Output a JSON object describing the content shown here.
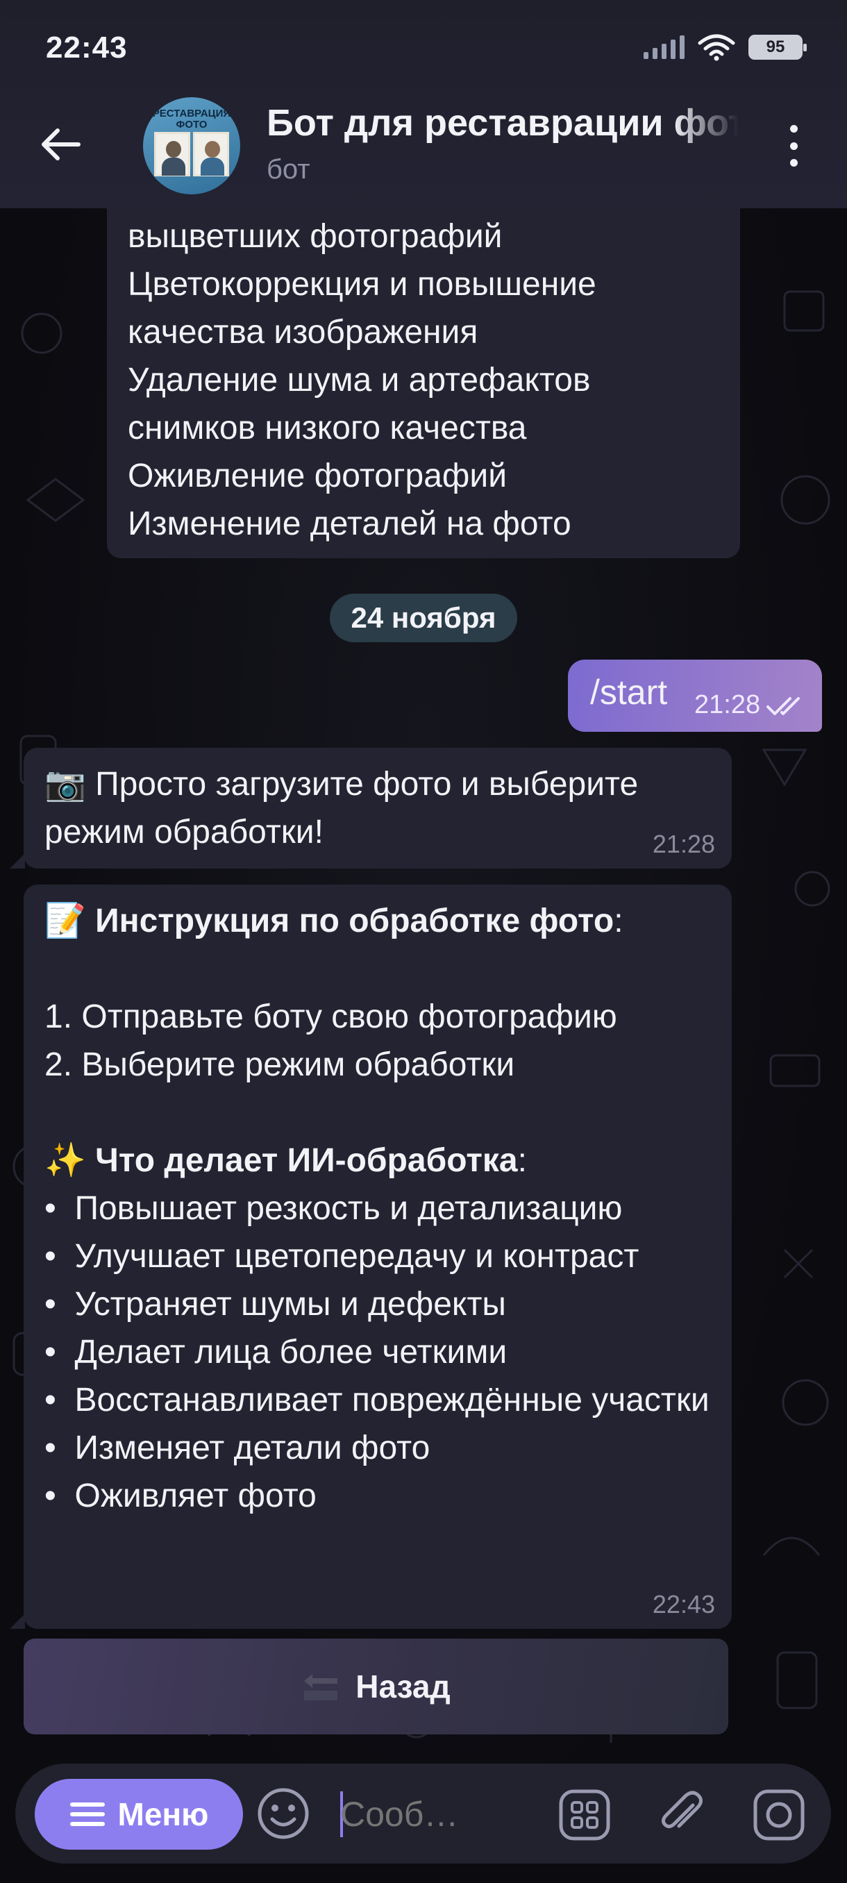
{
  "status_bar": {
    "time": "22:43",
    "battery": "95"
  },
  "header": {
    "title": "Бот для реставрации фото",
    "subtitle": "бот",
    "avatar_text": "РЕСТАВРАЦИЯ ФОТО"
  },
  "messages": {
    "first_fragment": "выцветших фотографий\nЦветокоррекция и повышение качества изображения\nУдаление шума и артефактов снимков низкого качества\nОживление фотографий\nИзменение деталей на фото",
    "date": "24 ноября",
    "outgoing": {
      "text": "/start",
      "time": "21:28"
    },
    "bot_reply": {
      "icon": "📷",
      "text": "Просто загрузите фото и выберите режим обработки!",
      "time": "21:28"
    },
    "instructions": {
      "icon": "📝",
      "heading": "Инструкция по обработке фото",
      "steps": "1. Отправьте боту свою фотографию\n2. Выберите режим обработки",
      "features_icon": "✨",
      "features_heading": "Что делает ИИ-обработка",
      "features": "•  Повышает резкость и детализацию\n•  Улучшает цветопередачу и контраст\n•  Устраняет шумы и дефекты\n•  Делает лица более четкими\n•  Восстанавливает повреждённые участки\n•  Изменяет детали фото\n•  Оживляет фото",
      "time": "22:43"
    }
  },
  "inline_button": {
    "label": "Назад"
  },
  "input_bar": {
    "menu_label": "Меню",
    "placeholder": "Сооб…"
  },
  "colors": {
    "accent": "#8d7ef0",
    "bubble": "#232331",
    "outgoing_start": "#7d6bd0",
    "outgoing_end": "#a383c9",
    "date_chip": "#2a3d48"
  }
}
